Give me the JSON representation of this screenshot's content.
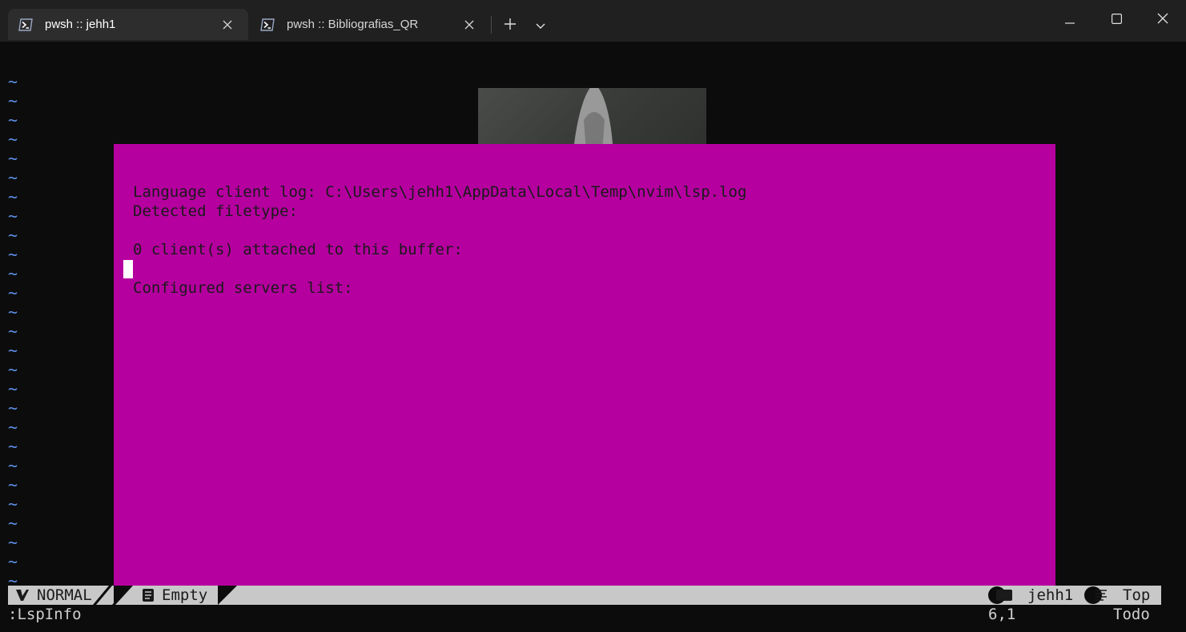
{
  "window": {
    "tabs": [
      {
        "title": "pwsh :: jehh1",
        "active": true
      },
      {
        "title": "pwsh :: Bibliografias_QR",
        "active": false
      }
    ]
  },
  "editor": {
    "empty_line_marker": "~",
    "lsp_info": {
      "lines": [
        "Language client log: C:\\Users\\jehh1\\AppData\\Local\\Temp\\nvim\\lsp.log",
        "Detected filetype:",
        "0 client(s) attached to this buffer:",
        "Configured servers list:"
      ]
    }
  },
  "statusline": {
    "mode": "NORMAL",
    "file": "Empty",
    "directory": "jehh1",
    "position_label": "Top"
  },
  "cmdline": {
    "text": ":LspInfo",
    "cursor_pos": "6,1",
    "scroll": "Todo"
  },
  "colors": {
    "float_bg": "#b5009f",
    "tilde": "#5e8fe8",
    "statusline_bg": "#c8c8c8",
    "terminal_bg": "#0c0c0c"
  },
  "icons": {
    "tab": "powershell-icon",
    "close": "close-icon",
    "new_tab": "plus-icon",
    "dropdown": "chevron-down-icon",
    "mode": "vim-icon",
    "file": "file-icon",
    "directory": "folder-icon",
    "position": "lines-icon"
  }
}
